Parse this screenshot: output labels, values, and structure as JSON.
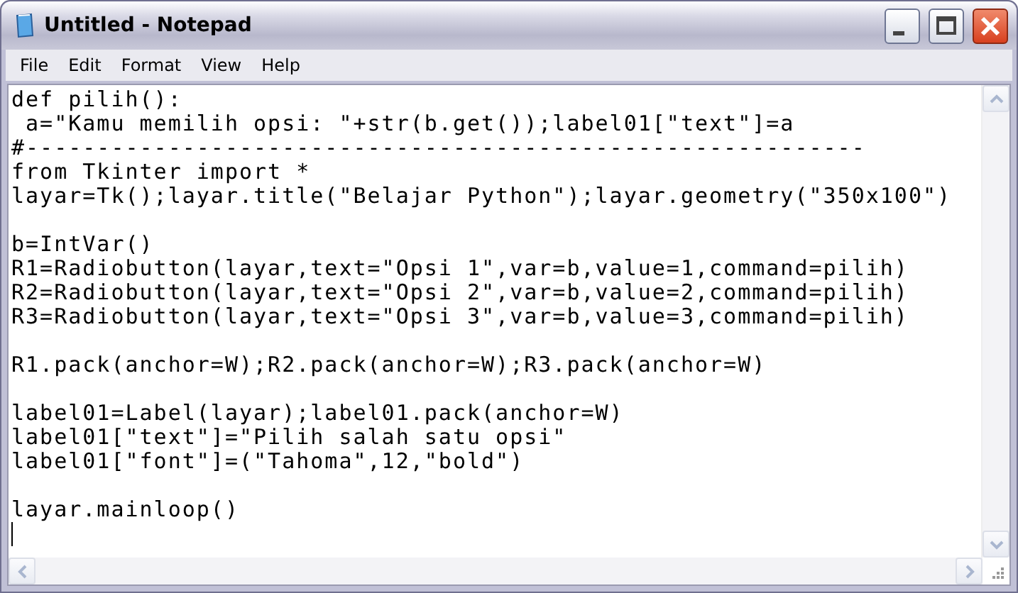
{
  "window": {
    "title": "Untitled - Notepad"
  },
  "menu": [
    {
      "label": "File"
    },
    {
      "label": "Edit"
    },
    {
      "label": "Format"
    },
    {
      "label": "View"
    },
    {
      "label": "Help"
    }
  ],
  "editor": {
    "blocks": [
      [
        "def pilih():",
        " a=\"Kamu memilih opsi: \"+str(b.get());label01[\"text\"]=a",
        "#-----------------------------------------------------------",
        "from Tkinter import *",
        "layar=Tk();layar.title(\"Belajar Python\");layar.geometry(\"350x100\")"
      ],
      [
        "b=IntVar()",
        "R1=Radiobutton(layar,text=\"Opsi 1\",var=b,value=1,command=pilih)",
        "R2=Radiobutton(layar,text=\"Opsi 2\",var=b,value=2,command=pilih)",
        "R3=Radiobutton(layar,text=\"Opsi 3\",var=b,value=3,command=pilih)"
      ],
      [
        "R1.pack(anchor=W);R2.pack(anchor=W);R3.pack(anchor=W)"
      ],
      [
        "label01=Label(layar);label01.pack(anchor=W)",
        "label01[\"text\"]=\"Pilih salah satu opsi\"",
        "label01[\"font\"]=(\"Tahoma\",12,\"bold\")"
      ],
      [
        "layar.mainloop()"
      ]
    ]
  }
}
